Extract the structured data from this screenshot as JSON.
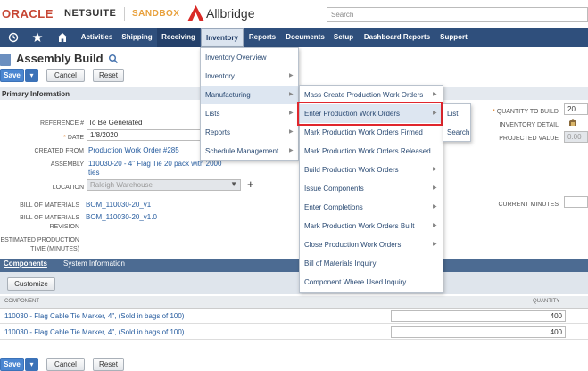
{
  "brand": {
    "oracle": "ORACLE",
    "netsuite": "NETSUITE",
    "sandbox": "SANDBOX",
    "company": "Allbridge",
    "search_placeholder": "Search"
  },
  "nav": {
    "items": [
      "Activities",
      "Shipping",
      "Receiving",
      "Inventory",
      "Reports",
      "Documents",
      "Setup",
      "Dashboard Reports",
      "Support"
    ],
    "active": "Receiving",
    "open": "Inventory"
  },
  "page": {
    "title": "Assembly Build",
    "save": "Save",
    "cancel": "Cancel",
    "reset": "Reset",
    "section": "Primary Information"
  },
  "form": {
    "reference_label": "REFERENCE #",
    "reference_value": "To Be Generated",
    "date_label": "DATE",
    "date_value": "1/8/2020",
    "created_from_label": "CREATED FROM",
    "created_from_value": "Production Work Order #285",
    "assembly_label": "ASSEMBLY",
    "assembly_value_1": "110030-20 - 4\" Flag Tie 20 pack with 2000",
    "assembly_value_2": "ties",
    "location_label": "LOCATION",
    "location_value": "Raleigh Warehouse",
    "bom_label": "BILL OF MATERIALS",
    "bom_value": "BOM_110030-20_v1",
    "bom_rev_label_1": "BILL OF MATERIALS",
    "bom_rev_label_2": "REVISION",
    "bom_rev_value": "BOM_110030-20_v1.0",
    "est_time_label_1": "ESTIMATED PRODUCTION",
    "est_time_label_2": "TIME (MINUTES)",
    "qty_label": "QUANTITY TO BUILD",
    "qty_value": "20",
    "inv_detail_label": "INVENTORY DETAIL",
    "proj_value_label": "PROJECTED VALUE",
    "proj_value": "0.00",
    "current_minutes_label": "CURRENT MINUTES"
  },
  "tabs": {
    "components": "Components",
    "system": "System Information"
  },
  "components": {
    "customize": "Customize",
    "columns": [
      "COMPONENT",
      "QUANTITY"
    ],
    "rows": [
      {
        "name": "110030 - Flag Cable Tie Marker, 4\", (Sold in bags of 100)",
        "qty": "400"
      },
      {
        "name": "110030 - Flag Cable Tie Marker, 4\", (Sold in bags of 100)",
        "qty": "400"
      }
    ]
  },
  "menus": {
    "inventory": [
      "Inventory Overview",
      "Inventory",
      "Manufacturing",
      "Lists",
      "Reports",
      "Schedule Management"
    ],
    "manufacturing": [
      "Mass Create Production Work Orders",
      "Enter Production Work Orders",
      "Mark Production Work Orders Firmed",
      "Mark Production Work Orders Released",
      "Build Production Work Orders",
      "Issue Components",
      "Enter Completions",
      "Mark Production Work Orders Built",
      "Close Production Work Orders",
      "Bill of Materials Inquiry",
      "Component Where Used Inquiry"
    ],
    "submenu": [
      "List",
      "Search"
    ]
  },
  "colors": {
    "nav": "#2f4f7c",
    "accent": "#c74634",
    "highlight": "#e0262d",
    "link": "#255b9e"
  }
}
